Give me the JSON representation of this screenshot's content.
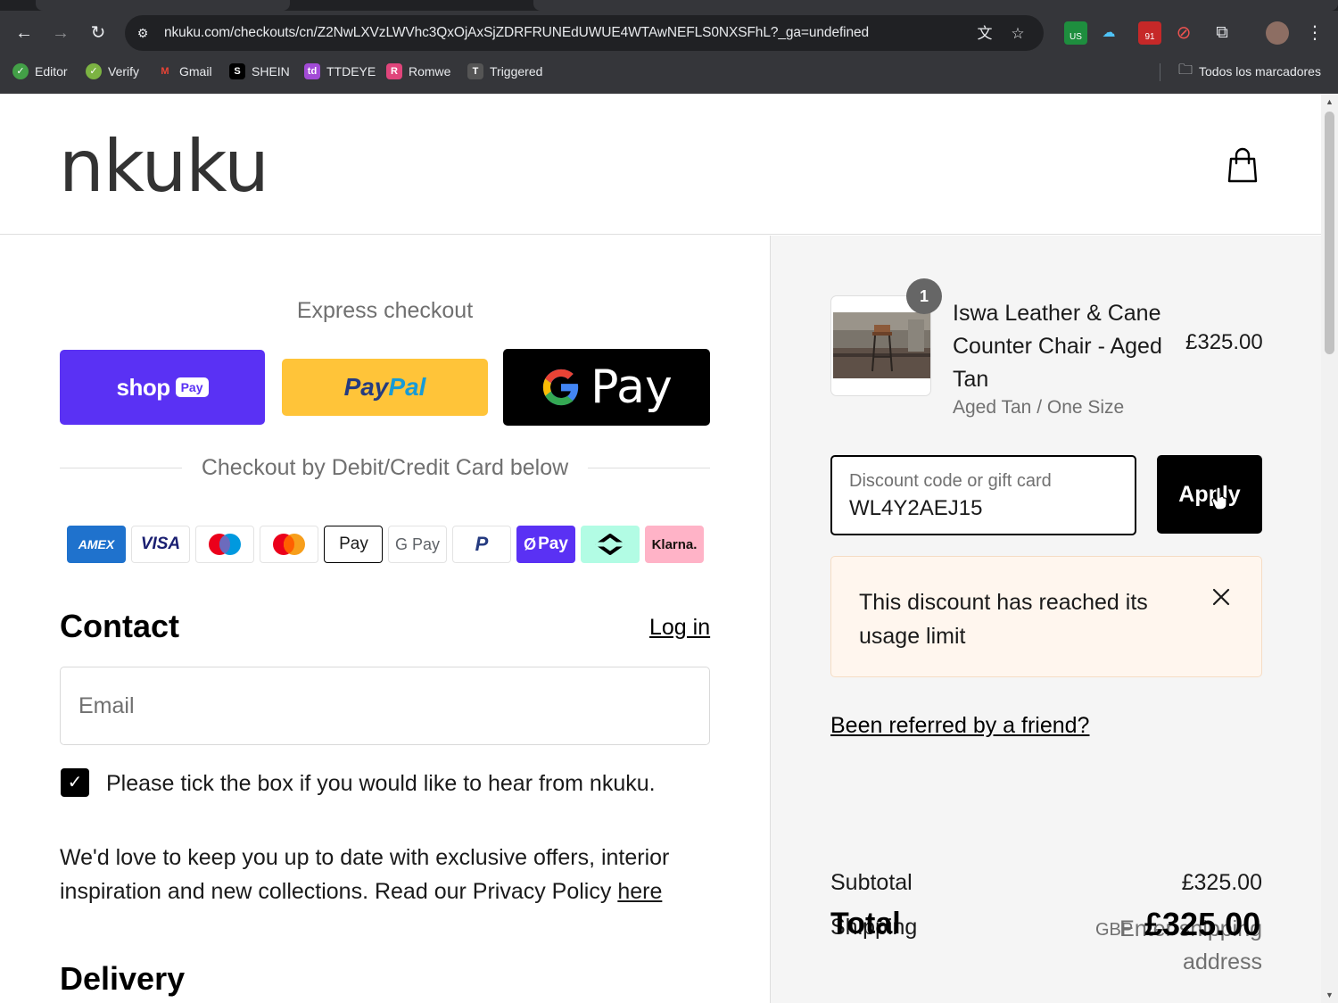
{
  "browser": {
    "url": "nkuku.com/checkouts/cn/Z2NwLXVzLWVhc3QxOjAxSjZDRFRUNEdUWUE4WTAwNEFLS0NXSFhL?_ga=undefined",
    "bookmarks": [
      {
        "label": "Editor",
        "color": "#43a047",
        "icon": "✓"
      },
      {
        "label": "Verify",
        "color": "#7cb342",
        "icon": "✓"
      },
      {
        "label": "Gmail",
        "color": "#ea4335",
        "icon": "M"
      },
      {
        "label": "SHEIN",
        "color": "#000000",
        "icon": "S"
      },
      {
        "label": "TTDEYE",
        "color": "#a24bd6",
        "icon": "td"
      },
      {
        "label": "Romwe",
        "color": "#e0457b",
        "icon": "R"
      },
      {
        "label": "Triggered",
        "color": "#555555",
        "icon": "T"
      }
    ],
    "all_bookmarks": "Todos los marcadores",
    "ext_badge": "91",
    "ext_us": "US"
  },
  "header": {
    "logo": "nkuku"
  },
  "express": {
    "title": "Express checkout",
    "shop_pay": "shop",
    "shop_pay_pill": "Pay",
    "paypal_a": "Pay",
    "paypal_b": "Pal",
    "gpay": "Pay",
    "divider": "Checkout by Debit/Credit Card below"
  },
  "payment_cards": [
    "AMEX",
    "VISA",
    "",
    "",
    "Pay",
    "G Pay",
    "P",
    "Pay",
    "",
    "Klarna."
  ],
  "contact": {
    "title": "Contact",
    "login": "Log in",
    "email_placeholder": "Email",
    "newsletter_label": "Please tick the box if you would like to hear from nkuku.",
    "marketing_text": "We'd love to keep you up to date with exclusive offers, interior inspiration and new collections. Read our Privacy Policy ",
    "marketing_link": "here"
  },
  "delivery": {
    "title": "Delivery"
  },
  "order": {
    "quantity": "1",
    "product_name": "Iswa Leather & Cane Counter Chair - Aged Tan",
    "variant": "Aged Tan / One Size",
    "price": "£325.00",
    "discount_label": "Discount code or gift card",
    "discount_value": "WL4Y2AEJ15",
    "apply": "Apply",
    "alert": "This discount has reached its usage limit",
    "referral": "Been referred by a friend?",
    "subtotal_label": "Subtotal",
    "subtotal": "£325.00",
    "shipping_label": "Shipping",
    "shipping": "Enter shipping address",
    "total_label": "Total",
    "currency": "GBP",
    "total": "£325.00"
  },
  "colors": {
    "shop_pay": "#5a31f4",
    "paypal": "#ffc439",
    "alert_bg": "#fff6ee"
  }
}
